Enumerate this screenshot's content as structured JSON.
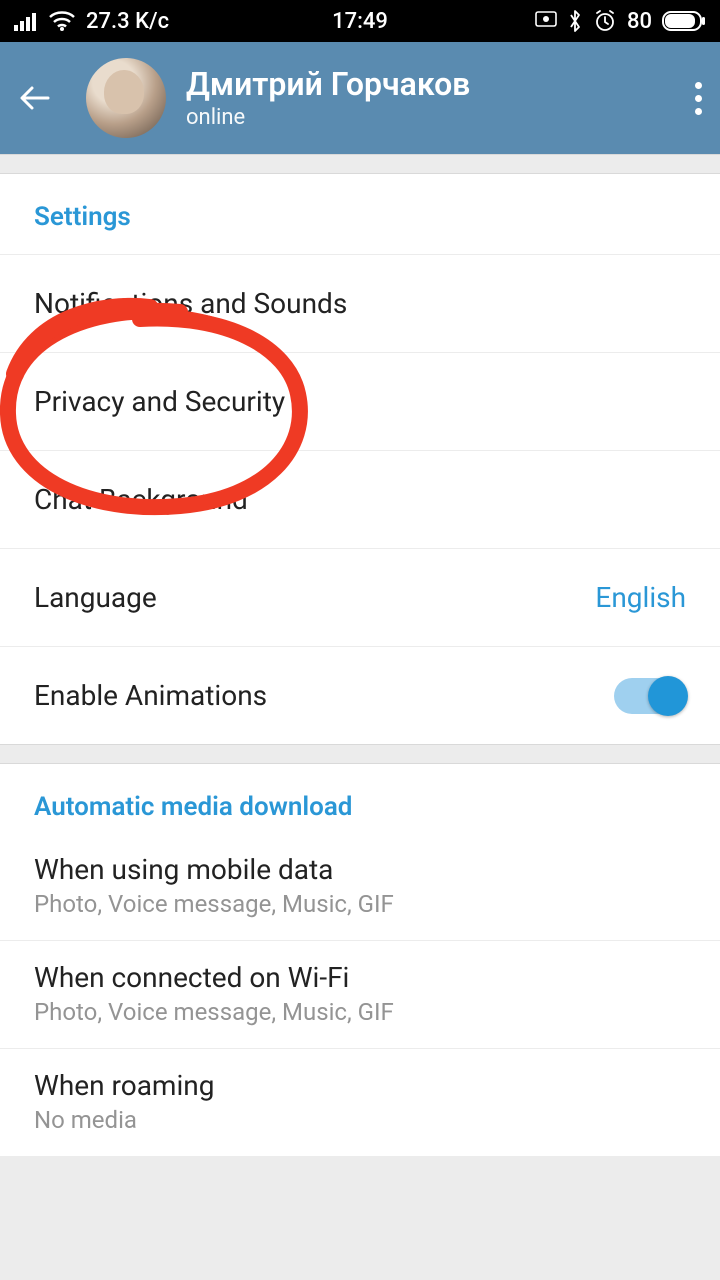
{
  "statusbar": {
    "speed": "27.3 K/c",
    "time": "17:49",
    "battery": "80"
  },
  "header": {
    "name": "Дмитрий Горчаков",
    "status": "online"
  },
  "settings": {
    "title": "Settings",
    "items": {
      "notifications": "Notifications and Sounds",
      "privacy": "Privacy and Security",
      "background": "Chat Background",
      "language_label": "Language",
      "language_value": "English",
      "animations": "Enable Animations"
    }
  },
  "media": {
    "title": "Automatic media download",
    "mobile": {
      "label": "When using mobile data",
      "sub": "Photo, Voice message, Music, GIF"
    },
    "wifi": {
      "label": "When connected on Wi-Fi",
      "sub": "Photo, Voice message, Music, GIF"
    },
    "roaming": {
      "label": "When roaming",
      "sub": "No media"
    }
  }
}
